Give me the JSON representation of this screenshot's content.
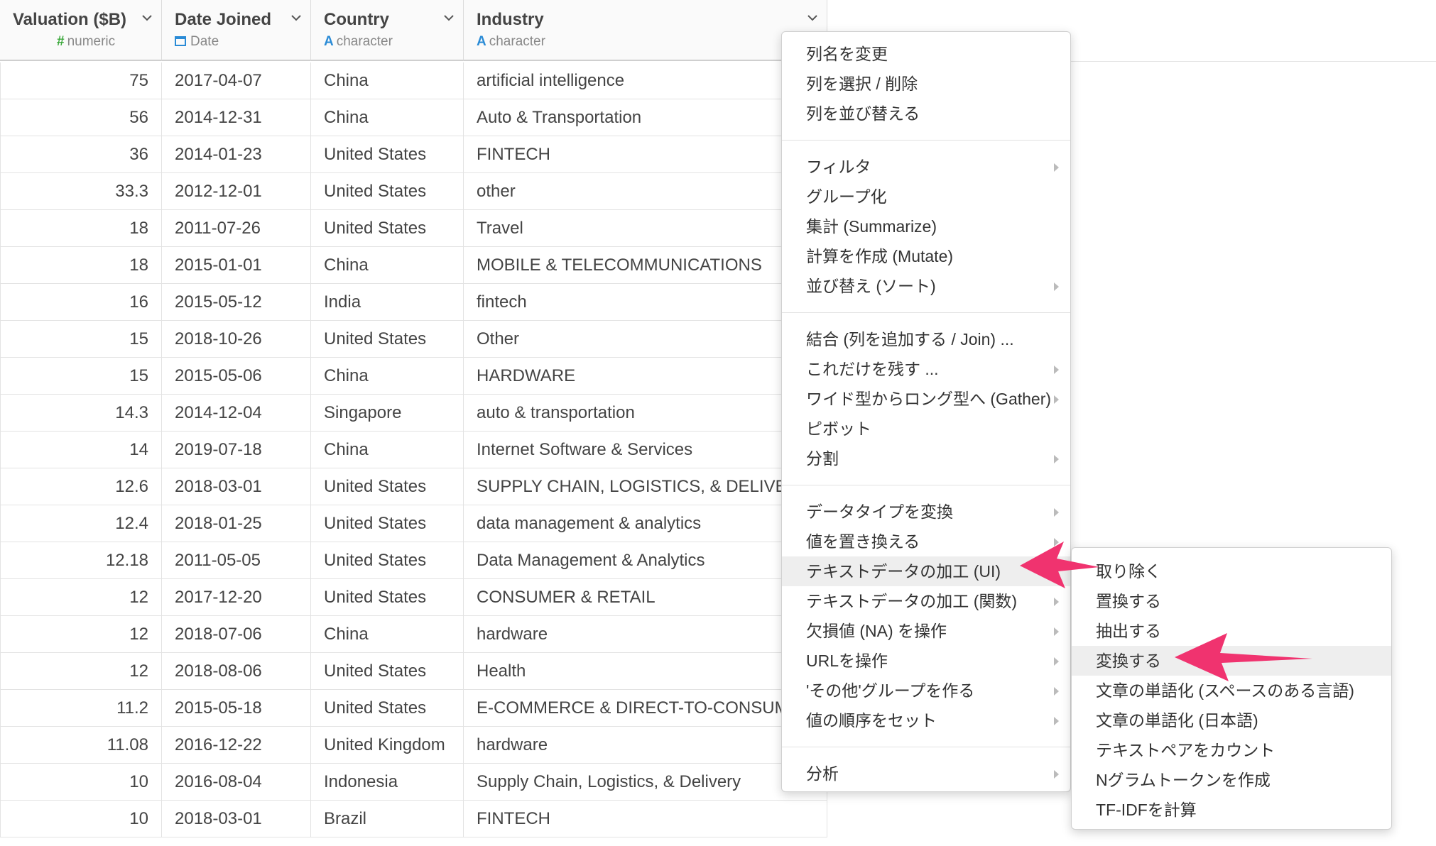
{
  "columns": [
    {
      "name": "Valuation ($B)",
      "type_icon": "#",
      "type_label": "numeric",
      "type_color": "#3aa83a"
    },
    {
      "name": "Date Joined",
      "type_icon": "calendar-icon",
      "type_label": "Date",
      "type_color": "#2a8bd6"
    },
    {
      "name": "Country",
      "type_icon": "A",
      "type_label": "character",
      "type_color": "#2a8bd6"
    },
    {
      "name": "Industry",
      "type_icon": "A",
      "type_label": "character",
      "type_color": "#2a8bd6"
    }
  ],
  "rows": [
    [
      "75",
      "2017-04-07",
      "China",
      "artificial intelligence"
    ],
    [
      "56",
      "2014-12-31",
      "China",
      "Auto & Transportation"
    ],
    [
      "36",
      "2014-01-23",
      "United States",
      "FINTECH"
    ],
    [
      "33.3",
      "2012-12-01",
      "United States",
      "other"
    ],
    [
      "18",
      "2011-07-26",
      "United States",
      "Travel"
    ],
    [
      "18",
      "2015-01-01",
      "China",
      "MOBILE & TELECOMMUNICATIONS"
    ],
    [
      "16",
      "2015-05-12",
      "India",
      "fintech"
    ],
    [
      "15",
      "2018-10-26",
      "United States",
      "Other"
    ],
    [
      "15",
      "2015-05-06",
      "China",
      "HARDWARE"
    ],
    [
      "14.3",
      "2014-12-04",
      "Singapore",
      "auto & transportation"
    ],
    [
      "14",
      "2019-07-18",
      "China",
      "Internet Software & Services"
    ],
    [
      "12.6",
      "2018-03-01",
      "United States",
      "SUPPLY CHAIN, LOGISTICS, & DELIVE"
    ],
    [
      "12.4",
      "2018-01-25",
      "United States",
      "data management & analytics"
    ],
    [
      "12.18",
      "2011-05-05",
      "United States",
      "Data Management & Analytics"
    ],
    [
      "12",
      "2017-12-20",
      "United States",
      "CONSUMER & RETAIL"
    ],
    [
      "12",
      "2018-07-06",
      "China",
      "hardware"
    ],
    [
      "12",
      "2018-08-06",
      "United States",
      "Health"
    ],
    [
      "11.2",
      "2015-05-18",
      "United States",
      "E-COMMERCE & DIRECT-TO-CONSUM"
    ],
    [
      "11.08",
      "2016-12-22",
      "United Kingdom",
      "hardware"
    ],
    [
      "10",
      "2016-08-04",
      "Indonesia",
      "Supply Chain, Logistics, & Delivery"
    ],
    [
      "10",
      "2018-03-01",
      "Brazil",
      "FINTECH"
    ]
  ],
  "context_menu": {
    "groups": [
      [
        {
          "label": "列名を変更",
          "submenu": false
        },
        {
          "label": "列を選択 / 削除",
          "submenu": false
        },
        {
          "label": "列を並び替える",
          "submenu": false
        }
      ],
      [
        {
          "label": "フィルタ",
          "submenu": true
        },
        {
          "label": "グループ化",
          "submenu": false
        },
        {
          "label": "集計 (Summarize)",
          "submenu": false
        },
        {
          "label": "計算を作成 (Mutate)",
          "submenu": false
        },
        {
          "label": "並び替え (ソート)",
          "submenu": true
        }
      ],
      [
        {
          "label": "結合 (列を追加する / Join) ...",
          "submenu": false
        },
        {
          "label": "これだけを残す ...",
          "submenu": true
        },
        {
          "label": "ワイド型からロング型へ (Gather)",
          "submenu": true
        },
        {
          "label": "ピボット",
          "submenu": false
        },
        {
          "label": "分割",
          "submenu": true
        }
      ],
      [
        {
          "label": "データタイプを変換",
          "submenu": true
        },
        {
          "label": "値を置き換える",
          "submenu": true
        },
        {
          "label": "テキストデータの加工 (UI)",
          "submenu": true,
          "highlighted": true
        },
        {
          "label": "テキストデータの加工 (関数)",
          "submenu": true
        },
        {
          "label": "欠損値 (NA) を操作",
          "submenu": true
        },
        {
          "label": "URLを操作",
          "submenu": true
        },
        {
          "label": "'その他'グループを作る",
          "submenu": true
        },
        {
          "label": "値の順序をセット",
          "submenu": true
        }
      ],
      [
        {
          "label": "分析",
          "submenu": true
        }
      ]
    ]
  },
  "submenu": {
    "items": [
      {
        "label": "取り除く"
      },
      {
        "label": "置換する"
      },
      {
        "label": "抽出する"
      },
      {
        "label": "変換する",
        "highlighted": true
      },
      {
        "label": "文章の単語化 (スペースのある言語)"
      },
      {
        "label": "文章の単語化 (日本語)"
      },
      {
        "label": "テキストペアをカウント"
      },
      {
        "label": "Nグラムトークンを作成"
      },
      {
        "label": "TF-IDFを計算"
      }
    ]
  },
  "colors": {
    "annotation_arrow": "#f0336f",
    "numeric_type": "#3aa83a",
    "character_type": "#2a8bd6"
  }
}
